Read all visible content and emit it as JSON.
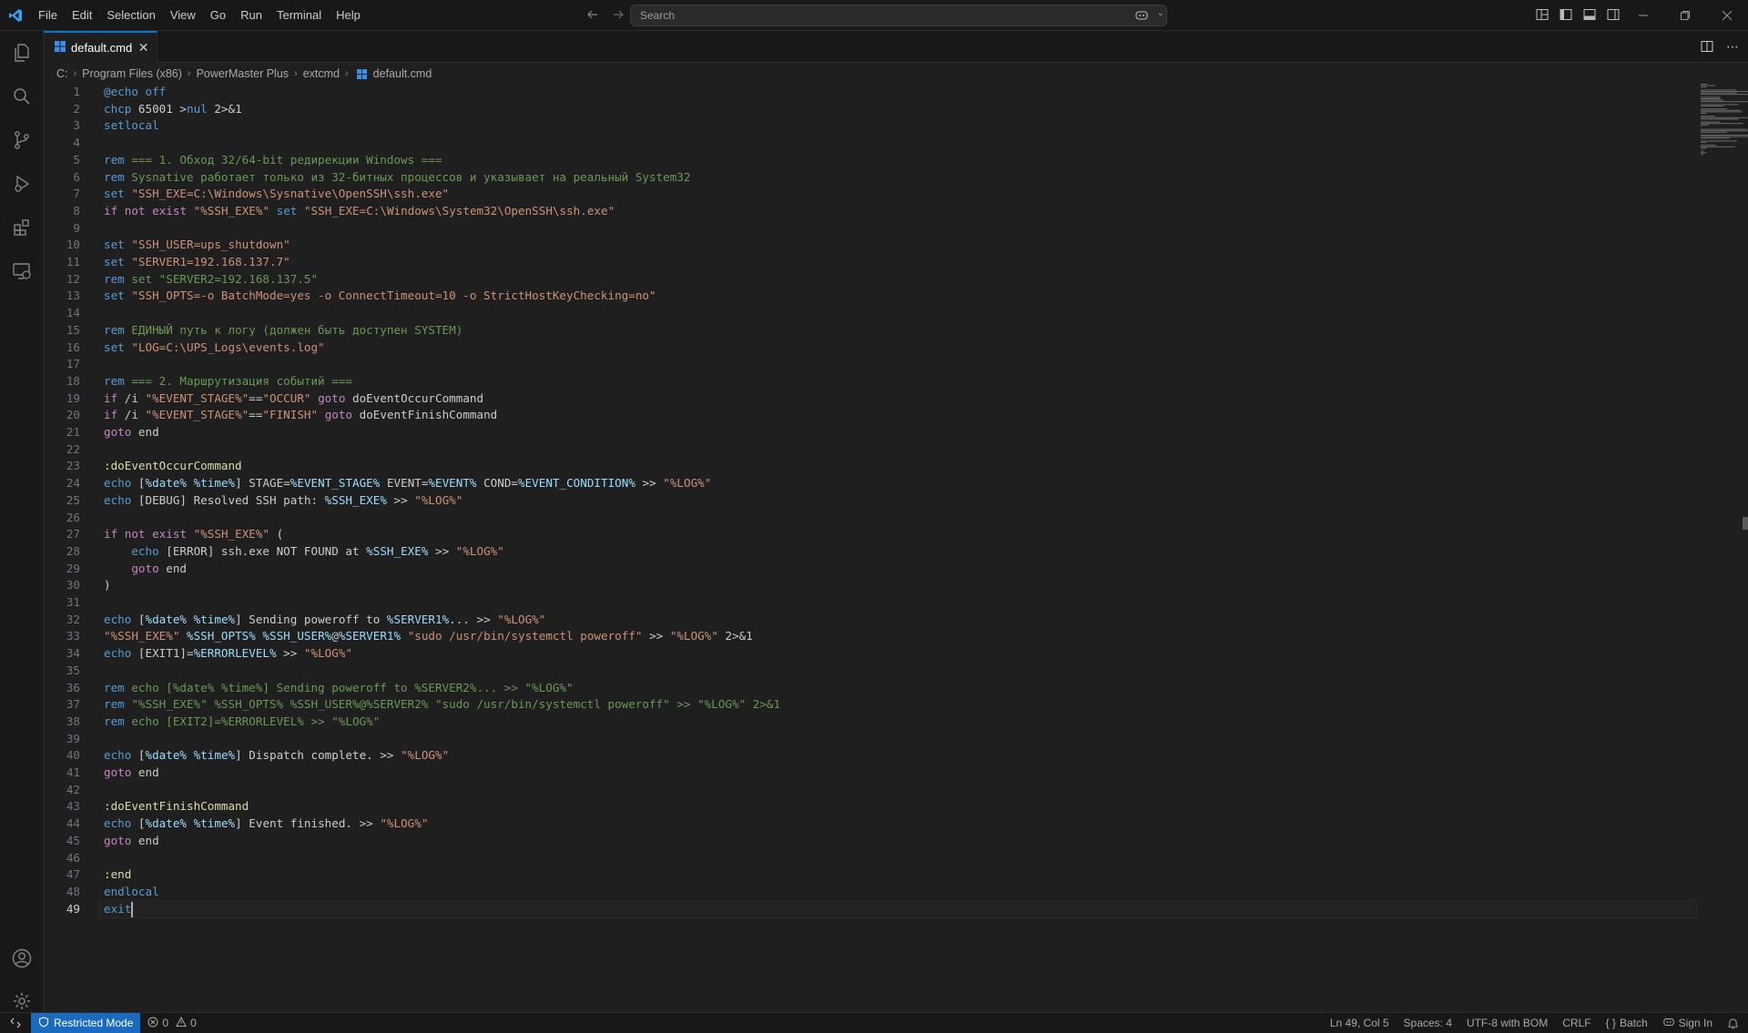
{
  "menu": [
    "File",
    "Edit",
    "Selection",
    "View",
    "Go",
    "Run",
    "Terminal",
    "Help"
  ],
  "search": {
    "placeholder": "Search"
  },
  "tab": {
    "name": "default.cmd"
  },
  "breadcrumb": [
    "C:",
    "Program Files (x86)",
    "PowerMaster Plus",
    "extcmd",
    "default.cmd"
  ],
  "editor": {
    "active_line": 49,
    "lines": [
      {
        "n": "1",
        "html": "<span class='kw'>@echo</span> <span class='kw'>off</span>"
      },
      {
        "n": "2",
        "html": "<span class='kw'>chcp</span> 65001 &gt;<span class='kw'>nul</span> 2&gt;&amp;1"
      },
      {
        "n": "3",
        "html": "<span class='kw'>setlocal</span>"
      },
      {
        "n": "4",
        "html": ""
      },
      {
        "n": "5",
        "html": "<span class='kw'>rem</span> <span class='cmt'>=== 1. Обход 32/64-bit редирекции Windows ===</span>"
      },
      {
        "n": "6",
        "html": "<span class='kw'>rem</span> <span class='cmt'>Sysnative работает только из 32-битных процессов и указывает на реальный System32</span>"
      },
      {
        "n": "7",
        "html": "<span class='kw'>set</span> <span class='str'>\"SSH_EXE=C:\\Windows\\Sysnative\\OpenSSH\\ssh.exe\"</span>"
      },
      {
        "n": "8",
        "html": "<span class='kw2'>if</span> <span class='kw2'>not</span> <span class='kw2'>exist</span> <span class='str'>\"%SSH_EXE%\"</span> <span class='kw'>set</span> <span class='str'>\"SSH_EXE=C:\\Windows\\System32\\OpenSSH\\ssh.exe\"</span>"
      },
      {
        "n": "9",
        "html": ""
      },
      {
        "n": "10",
        "html": "<span class='kw'>set</span> <span class='str'>\"SSH_USER=ups_shutdown\"</span>"
      },
      {
        "n": "11",
        "html": "<span class='kw'>set</span> <span class='str'>\"SERVER1=192.168.137.7\"</span>"
      },
      {
        "n": "12",
        "html": "<span class='kw'>rem</span> <span class='cmt'>set \"SERVER2=192.168.137.5\"</span>"
      },
      {
        "n": "13",
        "html": "<span class='kw'>set</span> <span class='str'>\"SSH_OPTS=-o BatchMode=yes -o ConnectTimeout=10 -o StrictHostKeyChecking=no\"</span>"
      },
      {
        "n": "14",
        "html": ""
      },
      {
        "n": "15",
        "html": "<span class='kw'>rem</span> <span class='cmt'>ЕДИНЫЙ путь к логу (должен быть доступен SYSTEM)</span>"
      },
      {
        "n": "16",
        "html": "<span class='kw'>set</span> <span class='str'>\"LOG=C:\\UPS_Logs\\events.log\"</span>"
      },
      {
        "n": "17",
        "html": ""
      },
      {
        "n": "18",
        "html": "<span class='kw'>rem</span> <span class='cmt'>=== 2. Маршрутизация событий ===</span>"
      },
      {
        "n": "19",
        "html": "<span class='kw2'>if</span> /i <span class='str'>\"%EVENT_STAGE%\"</span>==<span class='str'>\"OCCUR\"</span> <span class='kw2'>goto</span> doEventOccurCommand"
      },
      {
        "n": "20",
        "html": "<span class='kw2'>if</span> /i <span class='str'>\"%EVENT_STAGE%\"</span>==<span class='str'>\"FINISH\"</span> <span class='kw2'>goto</span> doEventFinishCommand"
      },
      {
        "n": "21",
        "html": "<span class='kw2'>goto</span> end"
      },
      {
        "n": "22",
        "html": ""
      },
      {
        "n": "23",
        "html": "<span class='lbl'>:doEventOccurCommand</span>"
      },
      {
        "n": "24",
        "html": "<span class='kw'>echo</span> [<span class='var'>%date%</span> <span class='var'>%time%</span>] STAGE=<span class='var'>%EVENT_STAGE%</span> EVENT=<span class='var'>%EVENT%</span> COND=<span class='var'>%EVENT_CONDITION%</span> &gt;&gt; <span class='str'>\"%LOG%\"</span>"
      },
      {
        "n": "25",
        "html": "<span class='kw'>echo</span> [DEBUG] Resolved SSH path: <span class='var'>%SSH_EXE%</span> &gt;&gt; <span class='str'>\"%LOG%\"</span>"
      },
      {
        "n": "26",
        "html": ""
      },
      {
        "n": "27",
        "html": "<span class='kw2'>if</span> <span class='kw2'>not</span> <span class='kw2'>exist</span> <span class='str'>\"%SSH_EXE%\"</span> <span class='lbl'>(</span>"
      },
      {
        "n": "28",
        "html": "    <span class='kw'>echo</span> [ERROR] ssh.exe NOT FOUND at <span class='var'>%SSH_EXE%</span> &gt;&gt; <span class='str'>\"%LOG%\"</span>"
      },
      {
        "n": "29",
        "html": "    <span class='kw2'>goto</span> end"
      },
      {
        "n": "30",
        "html": "<span class='lbl'>)</span>"
      },
      {
        "n": "31",
        "html": ""
      },
      {
        "n": "32",
        "html": "<span class='kw'>echo</span> [<span class='var'>%date%</span> <span class='var'>%time%</span>] Sending poweroff to <span class='var'>%SERVER1%</span>... &gt;&gt; <span class='str'>\"%LOG%\"</span>"
      },
      {
        "n": "33",
        "html": "<span class='str'>\"%SSH_EXE%\"</span> <span class='var'>%SSH_OPTS%</span> <span class='var'>%SSH_USER%</span>@<span class='var'>%SERVER1%</span> <span class='str'>\"sudo /usr/bin/systemctl poweroff\"</span> &gt;&gt; <span class='str'>\"%LOG%\"</span> 2&gt;&amp;1"
      },
      {
        "n": "34",
        "html": "<span class='kw'>echo</span> [EXIT1]=<span class='var'>%ERRORLEVEL%</span> &gt;&gt; <span class='str'>\"%LOG%\"</span>"
      },
      {
        "n": "35",
        "html": ""
      },
      {
        "n": "36",
        "html": "<span class='kw'>rem</span> <span class='cmt'>echo [%date% %time%] Sending poweroff to %SERVER2%... &gt;&gt; \"%LOG%\"</span>"
      },
      {
        "n": "37",
        "html": "<span class='kw'>rem</span> <span class='cmt'>\"%SSH_EXE%\" %SSH_OPTS% %SSH_USER%@%SERVER2% \"sudo /usr/bin/systemctl poweroff\" &gt;&gt; \"%LOG%\" 2&gt;&amp;1</span>"
      },
      {
        "n": "38",
        "html": "<span class='kw'>rem</span> <span class='cmt'>echo [EXIT2]=%ERRORLEVEL% &gt;&gt; \"%LOG%\"</span>"
      },
      {
        "n": "39",
        "html": ""
      },
      {
        "n": "40",
        "html": "<span class='kw'>echo</span> [<span class='var'>%date%</span> <span class='var'>%time%</span>] Dispatch complete. &gt;&gt; <span class='str'>\"%LOG%\"</span>"
      },
      {
        "n": "41",
        "html": "<span class='kw2'>goto</span> end"
      },
      {
        "n": "42",
        "html": ""
      },
      {
        "n": "43",
        "html": "<span class='lbl'>:doEventFinishCommand</span>"
      },
      {
        "n": "44",
        "html": "<span class='kw'>echo</span> [<span class='var'>%date%</span> <span class='var'>%time%</span>] Event finished. &gt;&gt; <span class='str'>\"%LOG%\"</span>"
      },
      {
        "n": "45",
        "html": "<span class='kw2'>goto</span> end"
      },
      {
        "n": "46",
        "html": ""
      },
      {
        "n": "47",
        "html": "<span class='lbl'>:end</span>"
      },
      {
        "n": "48",
        "html": "<span class='kw'>endlocal</span>"
      },
      {
        "n": "49",
        "html": "<span class='kw'>exit</span>"
      }
    ]
  },
  "status": {
    "restricted": "Restricted Mode",
    "errors": "0",
    "warnings": "0",
    "position": "Ln 49, Col 5",
    "spaces": "Spaces: 4",
    "encoding": "UTF-8 with BOM",
    "eol": "CRLF",
    "language": "Batch",
    "signin": "Sign In"
  },
  "colors": {
    "accent": "#0078d4",
    "restricted_bg": "#1a6bbf",
    "background": "#1f1f1f"
  }
}
